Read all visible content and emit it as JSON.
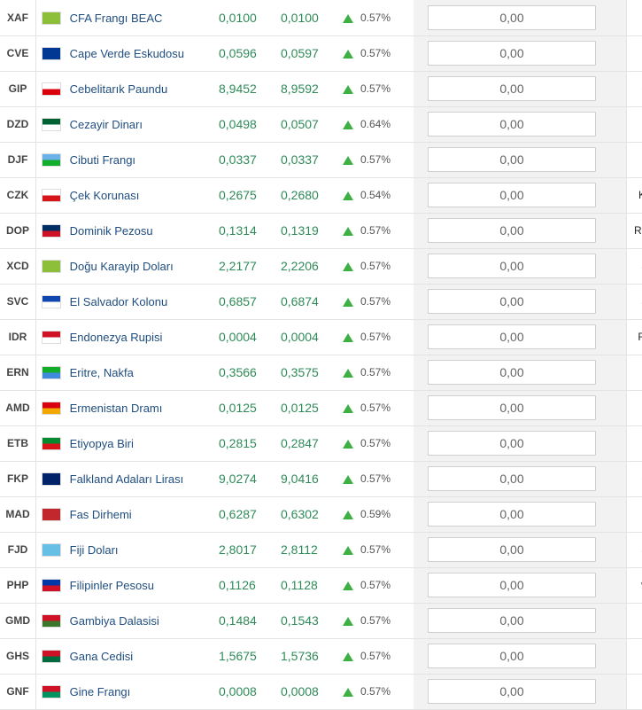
{
  "rows": [
    {
      "code": "XAF",
      "name": "CFA Frangı BEAC",
      "buy": "0,0100",
      "sell": "0,0100",
      "change": "0.57%",
      "amount": "0,00",
      "symbol": "",
      "flag": "generic-currency-flag",
      "flag_colors": [
        "#8dbf3a",
        "#8dbf3a"
      ]
    },
    {
      "code": "CVE",
      "name": "Cape Verde Eskudosu",
      "buy": "0,0596",
      "sell": "0,0597",
      "change": "0.57%",
      "amount": "0,00",
      "symbol": "",
      "flag": "cape-verde-flag",
      "flag_colors": [
        "#003893",
        "#003893"
      ]
    },
    {
      "code": "GIP",
      "name": "Cebelitarık Paundu",
      "buy": "8,9452",
      "sell": "8,9592",
      "change": "0.57%",
      "amount": "0,00",
      "symbol": "£",
      "flag": "gibraltar-flag",
      "flag_colors": [
        "#ffffff",
        "#da000c"
      ]
    },
    {
      "code": "DZD",
      "name": "Cezayir Dinarı",
      "buy": "0,0498",
      "sell": "0,0507",
      "change": "0.64%",
      "amount": "0,00",
      "symbol": "",
      "flag": "algeria-flag",
      "flag_colors": [
        "#006233",
        "#ffffff"
      ]
    },
    {
      "code": "DJF",
      "name": "Cibuti Frangı",
      "buy": "0,0337",
      "sell": "0,0337",
      "change": "0.57%",
      "amount": "0,00",
      "symbol": "",
      "flag": "djibouti-flag",
      "flag_colors": [
        "#6ab2e7",
        "#12ad2b"
      ]
    },
    {
      "code": "CZK",
      "name": "Çek Korunası",
      "buy": "0,2675",
      "sell": "0,2680",
      "change": "0.54%",
      "amount": "0,00",
      "symbol": "Kč",
      "flag": "czech-flag",
      "flag_colors": [
        "#ffffff",
        "#d7141a"
      ]
    },
    {
      "code": "DOP",
      "name": "Dominik Pezosu",
      "buy": "0,1314",
      "sell": "0,1319",
      "change": "0.57%",
      "amount": "0,00",
      "symbol": "RD$",
      "flag": "dominican-republic-flag",
      "flag_colors": [
        "#002d62",
        "#ce1126"
      ]
    },
    {
      "code": "XCD",
      "name": "Doğu Karayip Doları",
      "buy": "2,2177",
      "sell": "2,2206",
      "change": "0.57%",
      "amount": "0,00",
      "symbol": "$",
      "flag": "generic-currency-flag",
      "flag_colors": [
        "#8dbf3a",
        "#8dbf3a"
      ]
    },
    {
      "code": "SVC",
      "name": "El Salvador Kolonu",
      "buy": "0,6857",
      "sell": "0,6874",
      "change": "0.57%",
      "amount": "0,00",
      "symbol": "$",
      "flag": "el-salvador-flag",
      "flag_colors": [
        "#0f47af",
        "#ffffff"
      ]
    },
    {
      "code": "IDR",
      "name": "Endonezya Rupisi",
      "buy": "0,0004",
      "sell": "0,0004",
      "change": "0.57%",
      "amount": "0,00",
      "symbol": "Rp",
      "flag": "indonesia-flag",
      "flag_colors": [
        "#ce1126",
        "#ffffff"
      ]
    },
    {
      "code": "ERN",
      "name": "Eritre, Nakfa",
      "buy": "0,3566",
      "sell": "0,3575",
      "change": "0.57%",
      "amount": "0,00",
      "symbol": "",
      "flag": "eritrea-flag",
      "flag_colors": [
        "#12ad2b",
        "#4189dd"
      ]
    },
    {
      "code": "AMD",
      "name": "Ermenistan Dramı",
      "buy": "0,0125",
      "sell": "0,0125",
      "change": "0.57%",
      "amount": "0,00",
      "symbol": "",
      "flag": "armenia-flag",
      "flag_colors": [
        "#d90012",
        "#f2a800"
      ]
    },
    {
      "code": "ETB",
      "name": "Etiyopya Biri",
      "buy": "0,2815",
      "sell": "0,2847",
      "change": "0.57%",
      "amount": "0,00",
      "symbol": "",
      "flag": "ethiopia-flag",
      "flag_colors": [
        "#078930",
        "#da121a"
      ]
    },
    {
      "code": "FKP",
      "name": "Falkland Adaları Lirası",
      "buy": "9,0274",
      "sell": "9,0416",
      "change": "0.57%",
      "amount": "0,00",
      "symbol": "£",
      "flag": "falkland-flag",
      "flag_colors": [
        "#012169",
        "#012169"
      ]
    },
    {
      "code": "MAD",
      "name": "Fas Dirhemi",
      "buy": "0,6287",
      "sell": "0,6302",
      "change": "0.59%",
      "amount": "0,00",
      "symbol": "",
      "flag": "morocco-flag",
      "flag_colors": [
        "#c1272d",
        "#c1272d"
      ]
    },
    {
      "code": "FJD",
      "name": "Fiji Doları",
      "buy": "2,8017",
      "sell": "2,8112",
      "change": "0.57%",
      "amount": "0,00",
      "symbol": "$",
      "flag": "fiji-flag",
      "flag_colors": [
        "#68bfe5",
        "#68bfe5"
      ]
    },
    {
      "code": "PHP",
      "name": "Filipinler Pesosu",
      "buy": "0,1126",
      "sell": "0,1128",
      "change": "0.57%",
      "amount": "0,00",
      "symbol": "₱",
      "flag": "philippines-flag",
      "flag_colors": [
        "#0038a8",
        "#ce1126"
      ]
    },
    {
      "code": "GMD",
      "name": "Gambiya Dalasisi",
      "buy": "0,1484",
      "sell": "0,1543",
      "change": "0.57%",
      "amount": "0,00",
      "symbol": "",
      "flag": "gambia-flag",
      "flag_colors": [
        "#ce1126",
        "#3a7728"
      ]
    },
    {
      "code": "GHS",
      "name": "Gana Cedisi",
      "buy": "1,5675",
      "sell": "1,5736",
      "change": "0.57%",
      "amount": "0,00",
      "symbol": "¢",
      "flag": "ghana-flag",
      "flag_colors": [
        "#ce1126",
        "#006b3f"
      ]
    },
    {
      "code": "GNF",
      "name": "Gine Frangı",
      "buy": "0,0008",
      "sell": "0,0008",
      "change": "0.57%",
      "amount": "0,00",
      "symbol": "",
      "flag": "guinea-flag",
      "flag_colors": [
        "#ce1126",
        "#009460"
      ]
    }
  ],
  "arrow_color": "#3cb043",
  "value_color": "#2e8b57",
  "link_color": "#1f4d7f"
}
